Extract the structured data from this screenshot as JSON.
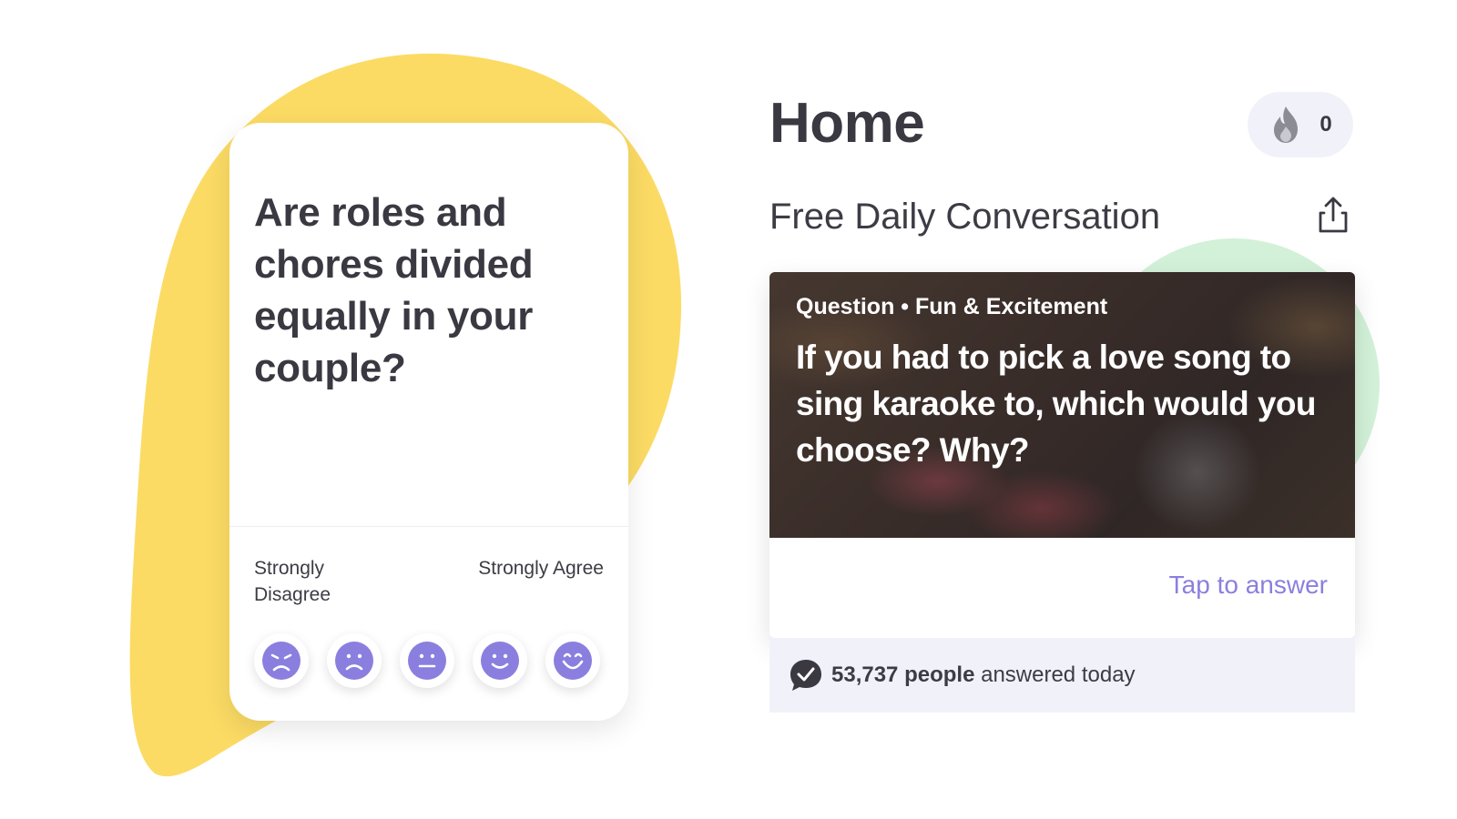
{
  "question_card": {
    "question": "Are roles and chores divided equally in your couple?",
    "scale_left": "Strongly Disagree",
    "scale_right": "Strongly Agree",
    "faces": [
      {
        "icon": "very-sad-face-icon"
      },
      {
        "icon": "sad-face-icon"
      },
      {
        "icon": "neutral-face-icon"
      },
      {
        "icon": "happy-face-icon"
      },
      {
        "icon": "very-happy-face-icon"
      }
    ],
    "accent_color": "#8a7fdf",
    "blob_color": "#fbdb64"
  },
  "home": {
    "title": "Home",
    "streak": {
      "icon": "flame-icon",
      "count": "0"
    },
    "section_title": "Free Daily Conversation",
    "share_icon": "share-icon",
    "conversation": {
      "type": "Question",
      "separator": "•",
      "category": "Fun & Excitement",
      "question": "If you had to pick a love song to sing karaoke to, which would you choose? Why?",
      "cta": "Tap to answer"
    },
    "answered": {
      "icon": "chat-check-icon",
      "count": "53,737 people",
      "suffix": "answered today"
    }
  }
}
